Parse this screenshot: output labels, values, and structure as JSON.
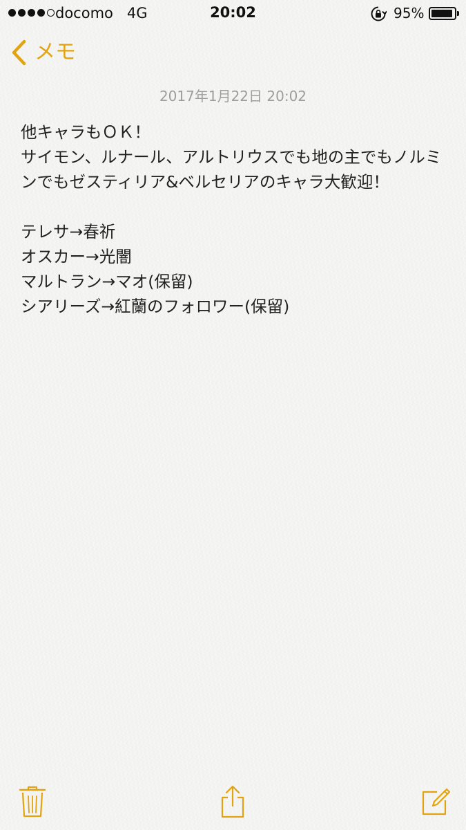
{
  "status_bar": {
    "carrier": "docomo",
    "network": "4G",
    "time": "20:02",
    "battery_percent": "95%",
    "battery_level": 0.95,
    "signal_bars_filled": 4,
    "signal_bars_total": 5
  },
  "nav": {
    "back_label": "メモ"
  },
  "note": {
    "date": "2017年1月22日 20:02",
    "lines": [
      "他キャラもＯＫ！",
      "サイモン、ルナール、アルトリウスでも地の主でもノルミ",
      "ンでもゼスティリア&ベルセリアのキャラ大歓迎！",
      "",
      "テレサ→春祈",
      "オスカー→光闇",
      "マルトラン→マオ(保留)",
      "シアリーズ→紅蘭のフォロワー(保留)"
    ]
  },
  "toolbar": {
    "trash_icon": "trash-icon",
    "share_icon": "share-icon",
    "compose_icon": "compose-icon"
  },
  "colors": {
    "accent": "#e2a311",
    "date_text": "#9d9d9d",
    "body_text": "#222222",
    "background": "#f4f4f2"
  }
}
